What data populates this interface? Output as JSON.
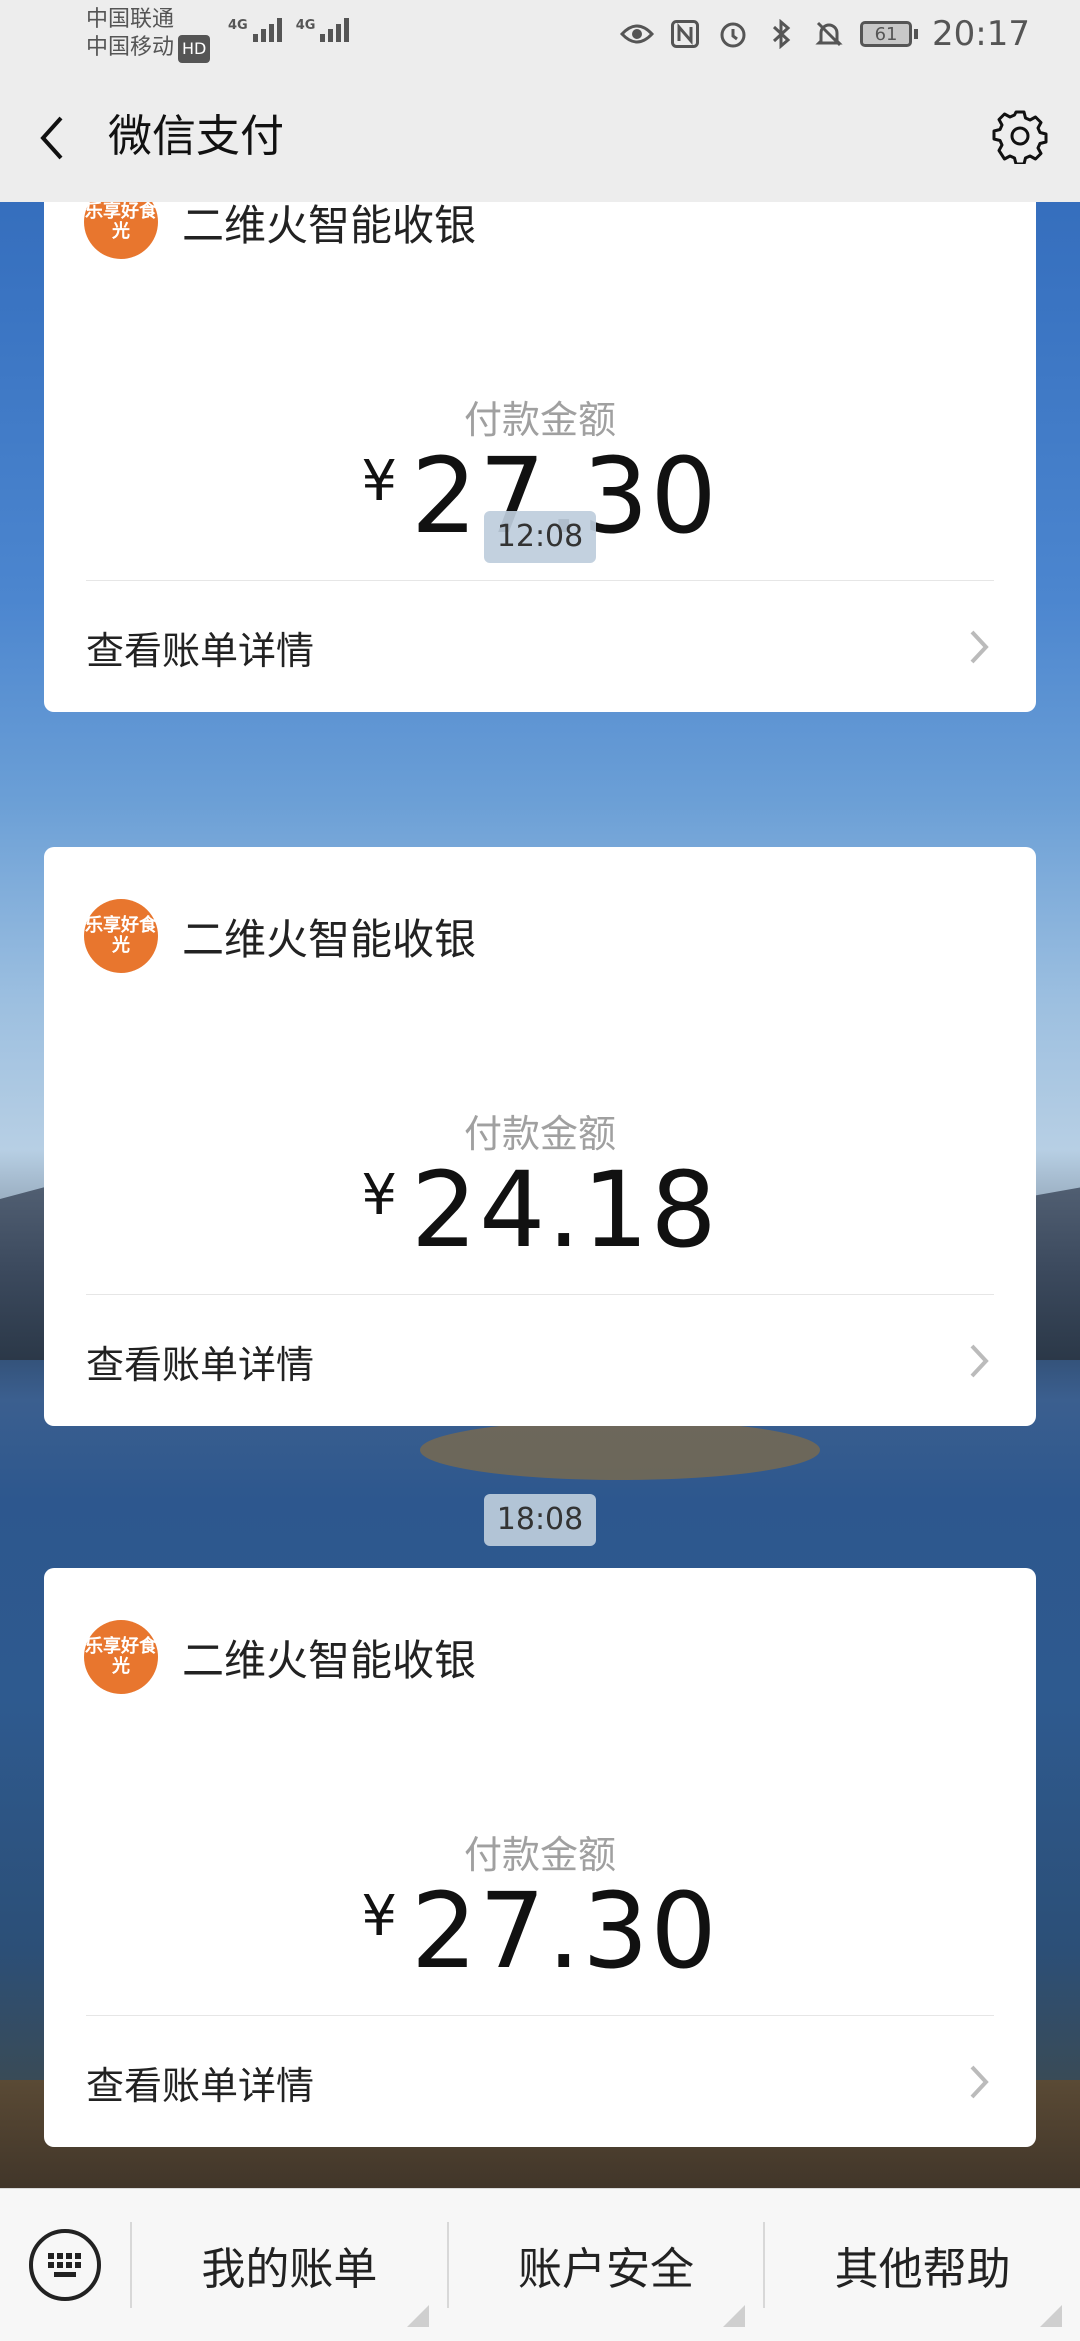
{
  "status_bar": {
    "carrier_1": "中国联通",
    "carrier_2": "中国移动",
    "hd_label": "HD",
    "network_1": "4G",
    "network_2": "4G",
    "battery_level": "61",
    "time": "20:17",
    "icons": [
      "eye-icon",
      "nfc-icon",
      "alarm-icon",
      "bluetooth-icon",
      "notifications-muted-icon"
    ]
  },
  "nav": {
    "title": "微信支付",
    "back_icon": "chevron-left-icon",
    "settings_icon": "gear-icon"
  },
  "payments": [
    {
      "merchant": "二维火智能收银",
      "logo_text": "乐享好食光",
      "amount_label": "付款金额",
      "currency": "¥",
      "amount": "27.30",
      "detail_label": "查看账单详情"
    },
    {
      "merchant": "二维火智能收银",
      "logo_text": "乐享好食光",
      "amount_label": "付款金额",
      "currency": "¥",
      "amount": "24.18",
      "detail_label": "查看账单详情"
    },
    {
      "merchant": "二维火智能收银",
      "logo_text": "乐享好食光",
      "amount_label": "付款金额",
      "currency": "¥",
      "amount": "27.30",
      "detail_label": "查看账单详情"
    }
  ],
  "timestamps": [
    "12:08",
    "18:08"
  ],
  "bottom_menu": {
    "keyboard_icon": "keyboard-icon",
    "items": [
      "我的账单",
      "账户安全",
      "其他帮助"
    ]
  },
  "colors": {
    "merchant_logo": "#e8762e",
    "card_bg": "#ffffff",
    "bar_bg": "#ededed"
  }
}
